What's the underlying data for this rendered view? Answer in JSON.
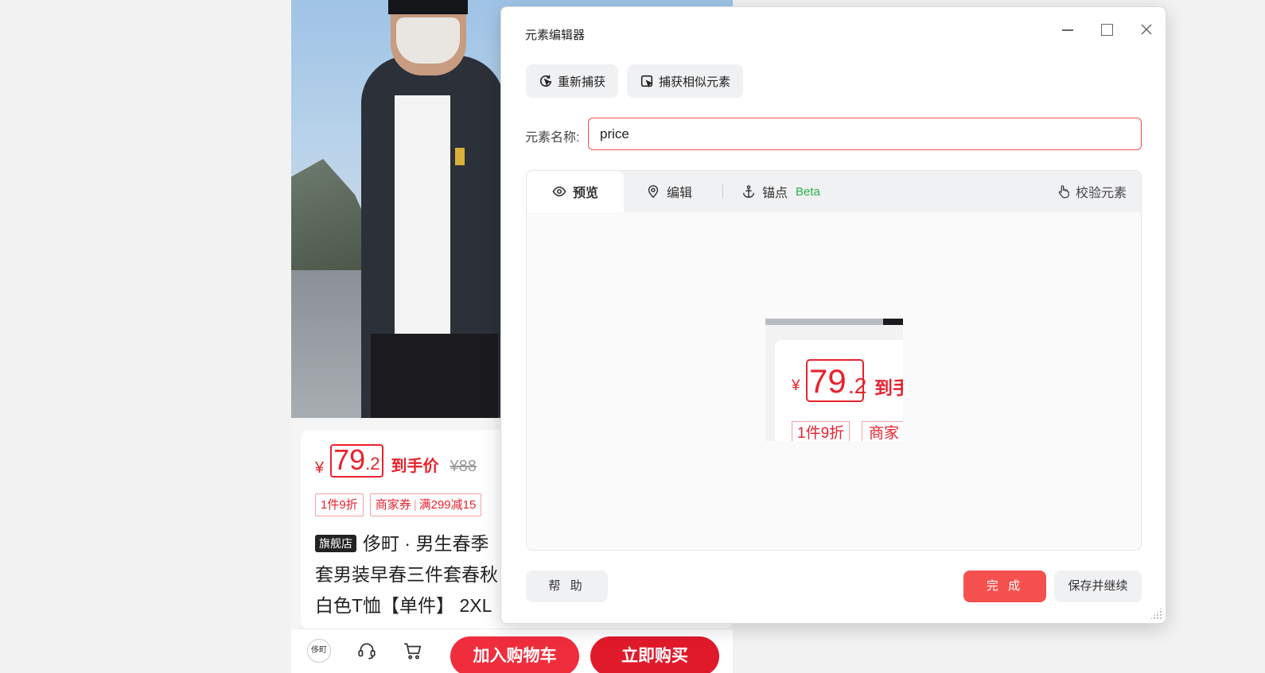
{
  "product": {
    "price_symbol": "¥",
    "price_integer": "79",
    "price_decimal": ".2",
    "price_label": "到手价",
    "original_price": "¥88",
    "tags": [
      {
        "text": "1件9折"
      },
      {
        "text": "商家券",
        "extra": "满299减15"
      }
    ],
    "flagship_badge": "旗舰店",
    "title_lines": [
      "侈町 · 男生春季",
      "套男装早春三件套春秋",
      "白色T恤【单件】 2XL"
    ],
    "shop_logo_text": "侈町",
    "add_to_cart": "加入购物车",
    "buy_now": "立即购买"
  },
  "dialog": {
    "title": "元素编辑器",
    "recapture_label": "重新捕获",
    "capture_similar_label": "捕获相似元素",
    "name_label": "元素名称:",
    "name_value": "price",
    "tabs": {
      "preview": "预览",
      "edit": "编辑",
      "anchor": "锚点",
      "anchor_badge": "Beta"
    },
    "verify_label": "校验元素",
    "preview_crop": {
      "yen": "¥",
      "integer": "79",
      "decimal": ".2",
      "label": "到手",
      "tag1": "1件9折",
      "tag2": "商家"
    },
    "help_label": "帮 助",
    "done_label": "完 成",
    "save_continue_label": "保存并继续"
  },
  "colors": {
    "accent_red": "#f4504e",
    "price_red": "#e8222e",
    "beta_green": "#2bb34a"
  }
}
